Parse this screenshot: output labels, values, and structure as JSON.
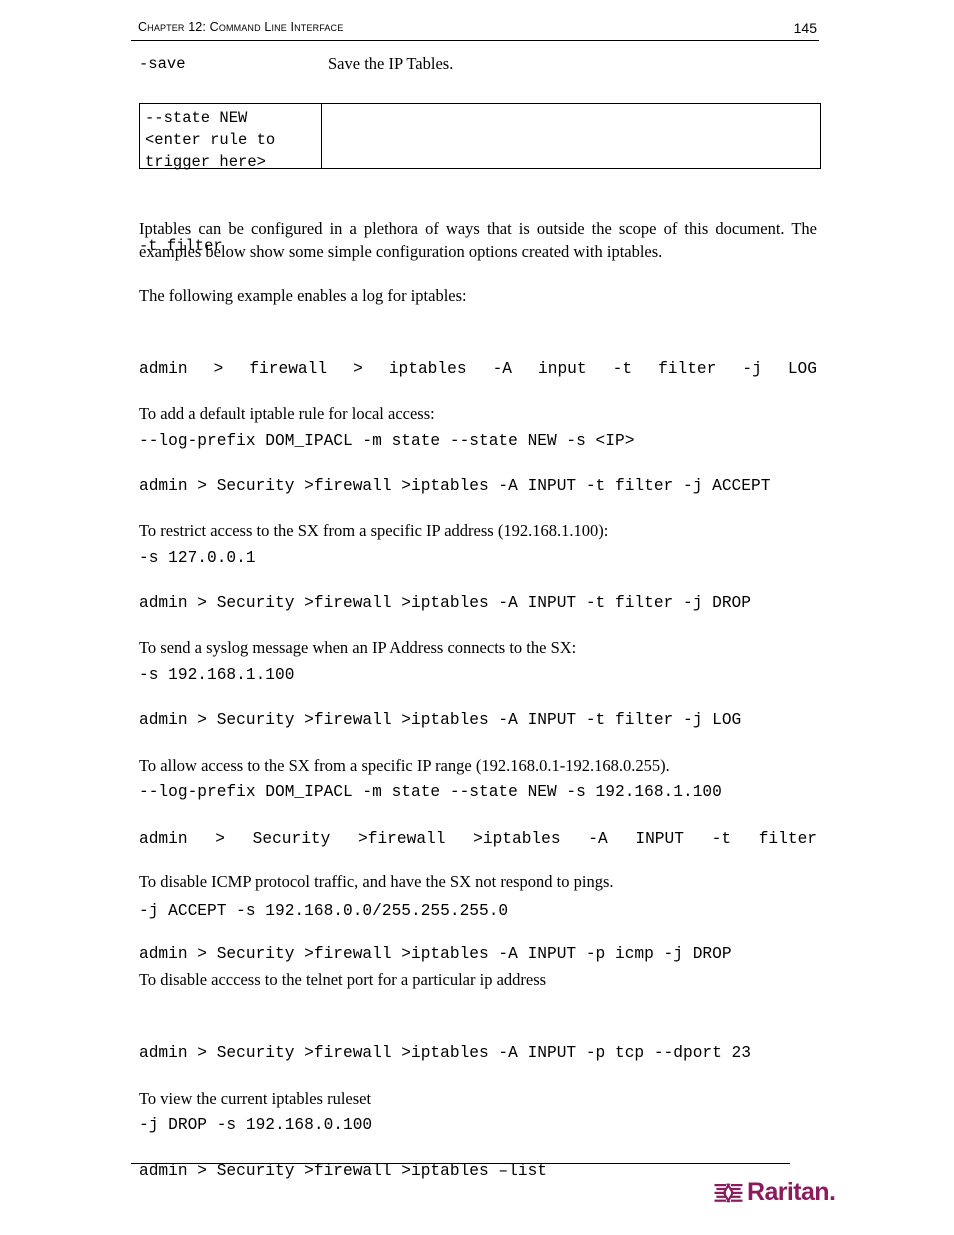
{
  "header": {
    "chapter_title": "Chapter 12: Command Line Interface",
    "page_number": "145"
  },
  "option_table": {
    "rows": [
      {
        "key": "-save",
        "desc": "Save the IP Tables."
      },
      {
        "key": "--state NEW\n<enter rule to\ntrigger here>",
        "desc": ""
      },
      {
        "key": "-t filter",
        "desc": ""
      }
    ]
  },
  "body": {
    "intro_paragraph": "Iptables can be configured in a plethora of ways that is outside the scope of this document. The examples below show some simple configuration options created with iptables.",
    "examples": [
      {
        "caption": "The following example enables a log for iptables:",
        "command_line1": "admin > firewall > iptables -A input -t filter -j LOG",
        "command_line2": "--log-prefix DOM_IPACL -m state --state NEW -s <IP>",
        "justified": true
      },
      {
        "caption": "To add a default iptable rule for local access:",
        "command_line1": "admin > Security >firewall >iptables -A INPUT -t filter -j ACCEPT",
        "command_line2": "-s 127.0.0.1",
        "justified": false
      },
      {
        "caption": "To restrict access to the SX from a specific IP address (192.168.1.100):",
        "command_line1": "admin > Security >firewall >iptables -A INPUT -t filter -j DROP",
        "command_line2": "-s 192.168.1.100",
        "justified": false
      },
      {
        "caption": "To send a syslog message when an IP Address connects to the SX:",
        "command_line1": "admin > Security >firewall >iptables -A INPUT -t filter -j LOG",
        "command_line2": "--log-prefix DOM_IPACL -m state --state NEW -s 192.168.1.100",
        "justified": false
      },
      {
        "caption": "To allow access to the SX from a specific IP range (192.168.0.1-192.168.0.255).",
        "command_line1": "admin > Security >firewall >iptables -A INPUT -t filter",
        "command_line2": "-j ACCEPT -s 192.168.0.0/255.255.255.0",
        "justified": true
      },
      {
        "caption": "To disable ICMP protocol traffic, and have the SX not respond to pings.",
        "command_line1": "admin > Security >firewall >iptables -A INPUT -p icmp -j DROP",
        "command_line2": "",
        "justified": false
      },
      {
        "caption": "To disable acccess to the telnet port for a particular ip address",
        "command_line1": "admin > Security >firewall >iptables -A INPUT -p tcp --dport 23",
        "command_line2": "-j DROP -s 192.168.0.100",
        "justified": false
      },
      {
        "caption": "To view the current iptables ruleset",
        "command_line1": "admin > Security >firewall >iptables –list",
        "command_line2": "",
        "justified": false
      }
    ]
  },
  "footer": {
    "brand_name": "Raritan",
    "brand_period": ".",
    "brand_color": "#8C1B5E"
  }
}
